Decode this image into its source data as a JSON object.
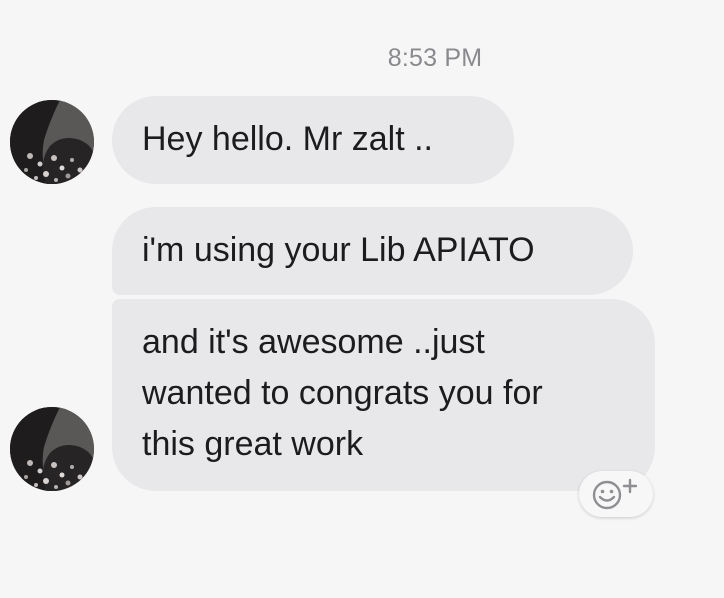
{
  "conversation": {
    "timestamp": "8:53 PM",
    "messages": [
      {
        "sender": "other",
        "text": "Hey hello. Mr zalt .."
      },
      {
        "sender": "other",
        "text": "i'm using your Lib APIATO"
      },
      {
        "sender": "other",
        "text": "and it's awesome ..just\nwanted to congrats you for\nthis great work"
      }
    ],
    "reaction_button_icon": "smiley-plus-icon"
  },
  "colors": {
    "background": "#f6f6f6",
    "bubble": "#e8e8ea",
    "timestamp_text": "#8a8a8e",
    "message_text": "#1c1c1e"
  }
}
